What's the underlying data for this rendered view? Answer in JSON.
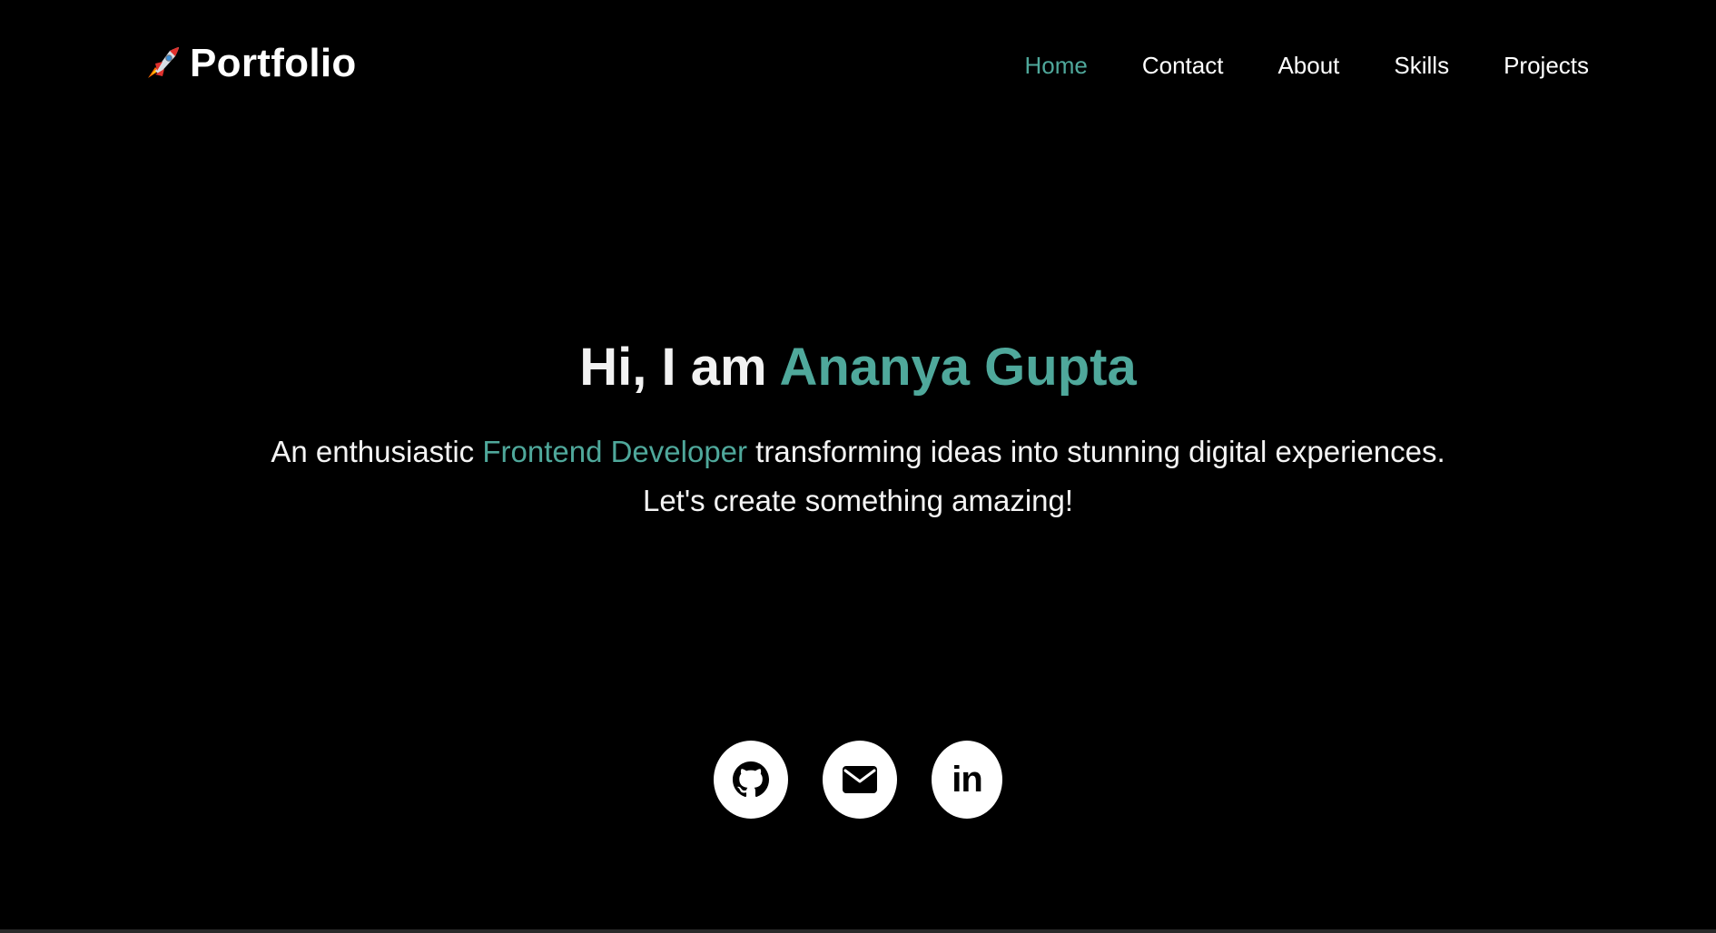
{
  "header": {
    "logo_icon": "rocket-icon",
    "logo_text": "Portfolio"
  },
  "nav": {
    "items": [
      {
        "label": "Home",
        "active": true
      },
      {
        "label": "Contact",
        "active": false
      },
      {
        "label": "About",
        "active": false
      },
      {
        "label": "Skills",
        "active": false
      },
      {
        "label": "Projects",
        "active": false
      }
    ]
  },
  "hero": {
    "title_prefix": "Hi, I am ",
    "title_name": "Ananya Gupta",
    "subtitle_prefix": "An enthusiastic ",
    "subtitle_role": "Frontend Developer",
    "subtitle_suffix": " transforming ideas into stunning digital experiences.",
    "subtitle_line2": "Let's create something amazing!"
  },
  "socials": [
    {
      "icon": "github-icon"
    },
    {
      "icon": "mail-icon"
    },
    {
      "icon": "linkedin-icon",
      "text": "in"
    }
  ],
  "colors": {
    "background": "#000000",
    "accent": "#4fa89b",
    "text": "#ffffff"
  }
}
